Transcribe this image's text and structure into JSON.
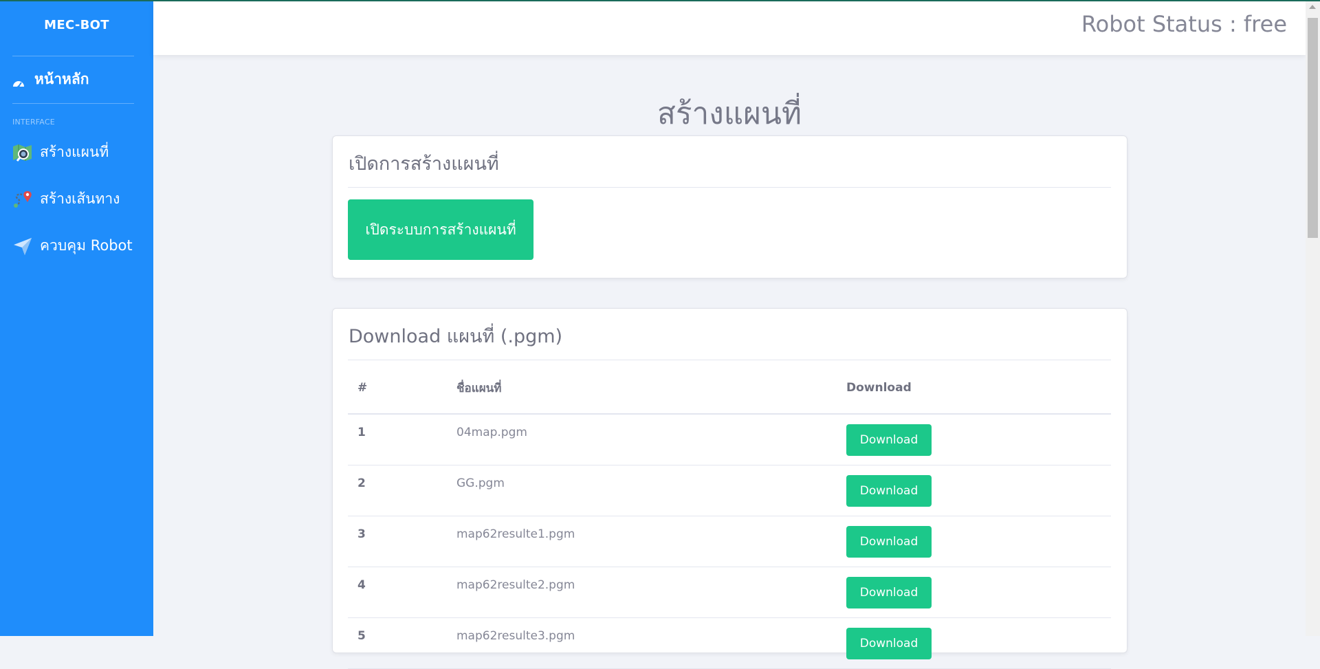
{
  "sidebar": {
    "brand": "MEC-BOT",
    "home_label": "หน้าหลัก",
    "section_label": "INTERFACE",
    "items": [
      {
        "label": "สร้างแผนที่",
        "icon": "map-search-icon"
      },
      {
        "label": "สร้างเส้นทาง",
        "icon": "route-pin-icon"
      },
      {
        "label": "ควบคุม Robot",
        "icon": "paper-plane-icon"
      }
    ]
  },
  "topbar": {
    "robot_status": "Robot Status : free"
  },
  "page": {
    "title": "สร้างแผนที่"
  },
  "create_card": {
    "title": "เปิดการสร้างแผนที่",
    "button_label": "เปิดระบบการสร้างแผนที่"
  },
  "download_card": {
    "title": "Download แผนที่ (.pgm)",
    "columns": [
      "#",
      "ชื่อแผนที่",
      "Download"
    ],
    "rows": [
      {
        "num": "1",
        "name": "04map.pgm",
        "button": "Download"
      },
      {
        "num": "2",
        "name": "GG.pgm",
        "button": "Download"
      },
      {
        "num": "3",
        "name": "map62resulte1.pgm",
        "button": "Download"
      },
      {
        "num": "4",
        "name": "map62resulte2.pgm",
        "button": "Download"
      },
      {
        "num": "5",
        "name": "map62resulte3.pgm",
        "button": "Download"
      }
    ]
  },
  "colors": {
    "sidebar": "#1f8dfb",
    "accent_green": "#1cc88a",
    "background": "#f1f3f8",
    "text": "#858796"
  }
}
